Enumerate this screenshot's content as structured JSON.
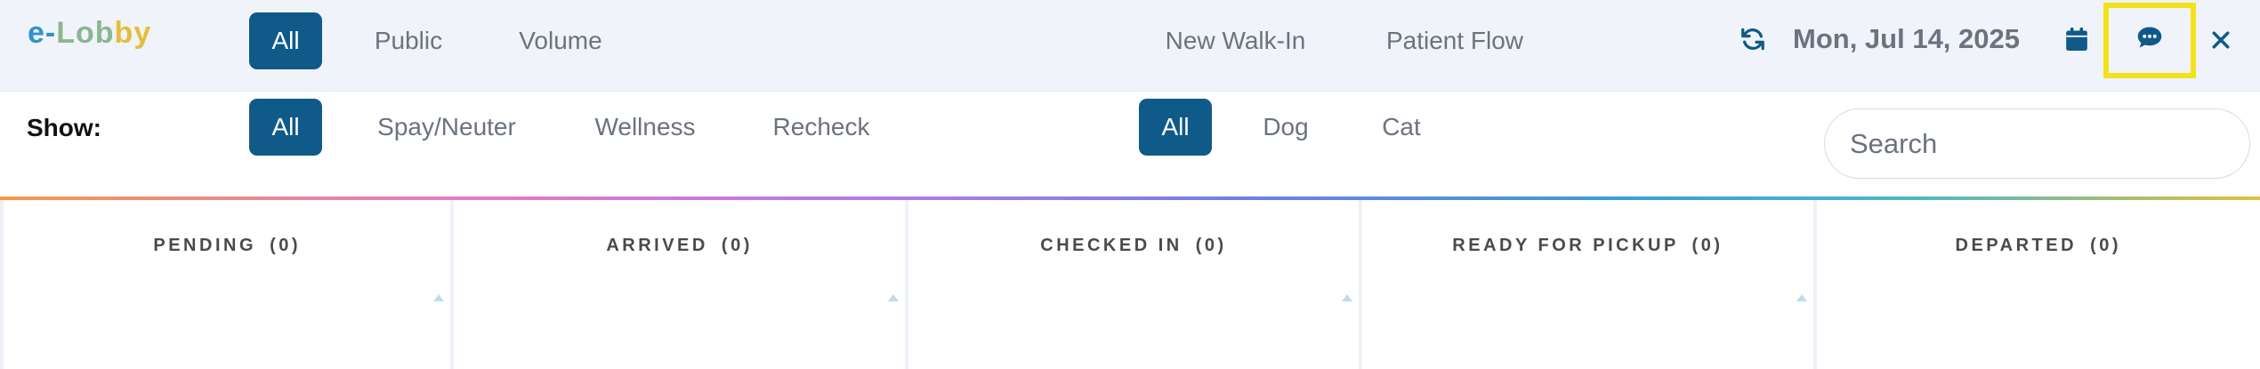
{
  "app": {
    "logo": {
      "seg1": "e-",
      "seg2": "Lob",
      "seg3": "by"
    }
  },
  "header": {
    "scope_filters": [
      {
        "label": "All",
        "active": true
      },
      {
        "label": "Public",
        "active": false
      },
      {
        "label": "Volume",
        "active": false
      }
    ],
    "actions": {
      "new_walk_in": "New Walk-In",
      "patient_flow": "Patient Flow"
    },
    "date": "Mon, Jul 14, 2025",
    "icons": [
      "refresh-icon",
      "calendar-icon",
      "chat-icon",
      "close-icon"
    ],
    "highlight_color": "#f2e21a"
  },
  "filters": {
    "show_label": "Show:",
    "visit_types": [
      {
        "label": "All",
        "active": true
      },
      {
        "label": "Spay/Neuter",
        "active": false
      },
      {
        "label": "Wellness",
        "active": false
      },
      {
        "label": "Recheck",
        "active": false
      }
    ],
    "species": [
      {
        "label": "All",
        "active": true
      },
      {
        "label": "Dog",
        "active": false
      },
      {
        "label": "Cat",
        "active": false
      }
    ],
    "search": {
      "placeholder": "Search",
      "value": ""
    }
  },
  "board": {
    "columns": [
      {
        "title": "PENDING",
        "count": "(0)"
      },
      {
        "title": "ARRIVED",
        "count": "(0)"
      },
      {
        "title": "CHECKED IN",
        "count": "(0)"
      },
      {
        "title": "READY FOR PICKUP",
        "count": "(0)"
      },
      {
        "title": "DEPARTED",
        "count": "(0)"
      }
    ]
  },
  "colors": {
    "accent": "#0f5a88",
    "text_muted": "#6b7280",
    "topbar_bg": "#f1f3fb"
  }
}
